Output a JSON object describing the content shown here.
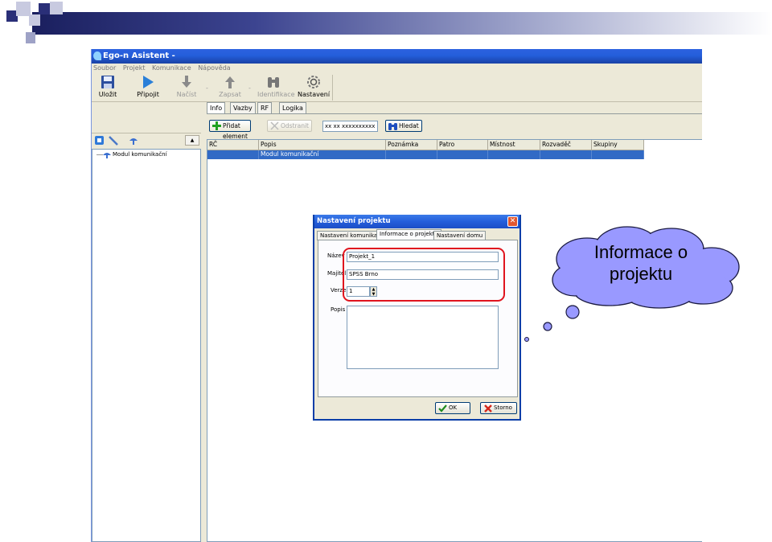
{
  "window": {
    "title": "Ego-n Asistent -",
    "menu": [
      "Soubor",
      "Projekt",
      "Komunikace",
      "Nápověda"
    ]
  },
  "toolbar": {
    "save": "Uložit",
    "connect": "Připojit",
    "load": "Načíst",
    "write": "Zapsat",
    "identify": "Identifikace",
    "settings": "Nastavení",
    "separator": "-"
  },
  "tree": {
    "root": "Modul komunikační"
  },
  "tabs": [
    "Info",
    "Vazby",
    "RF",
    "Logika"
  ],
  "actions": {
    "add": "Přidat element",
    "remove": "Odstranit",
    "search_value": "xx xx xxxxxxxxxx",
    "search": "Hledat"
  },
  "table": {
    "columns": [
      "RČ",
      "Popis",
      "Poznámka",
      "Patro",
      "Místnost",
      "Rozvaděč",
      "Skupiny"
    ],
    "rows": [
      [
        "",
        "Modul komunikační",
        "",
        "",
        "",
        "",
        ""
      ]
    ]
  },
  "dialog": {
    "title": "Nastavení projektu",
    "close": "✕",
    "tabs": [
      "Nastavení komunikace",
      "Informace o projektu",
      "Nastavení domu"
    ],
    "fields": {
      "name_label": "Název",
      "name_value": "Projekt_1",
      "owner_label": "Majitel",
      "owner_value": "SPSS Brno",
      "version_label": "Verze",
      "version_value": "1",
      "description_label": "Popis"
    },
    "ok": "OK",
    "cancel": "Storno"
  },
  "callout": {
    "text_line1": "Informace o",
    "text_line2": "projektu"
  },
  "colors": {
    "highlight": "#e0141e",
    "cloud_fill": "#9999ff",
    "selection": "#316ac5"
  }
}
